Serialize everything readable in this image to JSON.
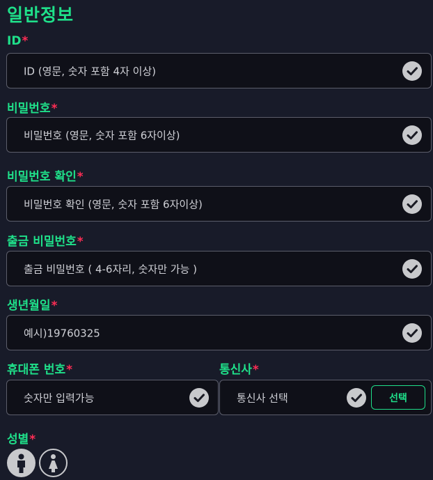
{
  "section_title": "일반정보",
  "required_mark": "*",
  "fields": {
    "id": {
      "label": "ID",
      "placeholder": "ID (영문, 숫자 포함 4자 이상)"
    },
    "password": {
      "label": "비밀번호",
      "placeholder": "비밀번호 (영문, 숫자 포함 6자이상)"
    },
    "password_confirm": {
      "label": "비밀번호 확인",
      "placeholder": "비밀번호 확인 (영문, 숫자 포함 6자이상)"
    },
    "withdraw_password": {
      "label": "출금 비밀번호",
      "placeholder": "출금 비밀번호 ( 4-6자리, 숫자만 가능 )"
    },
    "birthdate": {
      "label": "생년월일",
      "placeholder": "예시)19760325"
    },
    "phone": {
      "label": "휴대폰 번호",
      "placeholder": "숫자만 입력가능"
    },
    "carrier": {
      "label": "통신사",
      "placeholder": "통신사 선택",
      "button": "선택"
    },
    "gender": {
      "label": "성별"
    }
  },
  "colors": {
    "accent": "#1fe08a",
    "required": "#ff2d55",
    "background": "#181b29"
  },
  "icons": {
    "check": "check-circle-icon",
    "male": "male-icon",
    "female": "female-icon"
  }
}
